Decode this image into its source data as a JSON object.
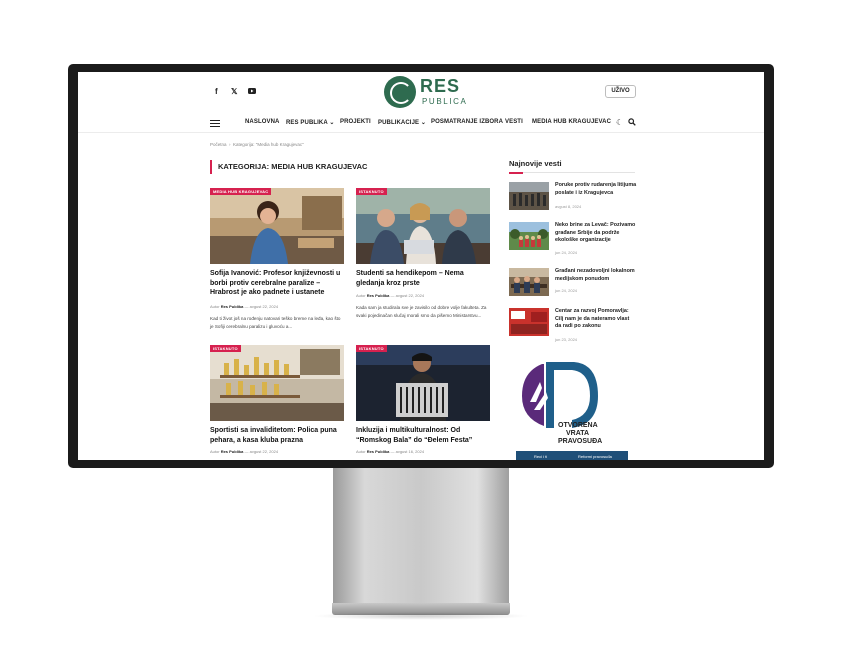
{
  "header": {
    "logo_top": "RES",
    "logo_bottom": "PUBLICA",
    "live_button": "UŽIVO",
    "social_icons": [
      "facebook-icon",
      "x-twitter-icon",
      "youtube-icon"
    ]
  },
  "nav": {
    "items": [
      {
        "label": "NASLOVNA"
      },
      {
        "label": "RES PUBLIKA ⌄"
      },
      {
        "label": "PROJEKTI"
      },
      {
        "label": "PUBLIKACIJE ⌄"
      },
      {
        "label": "POSMATRANJE IZBORA"
      },
      {
        "label": "VESTI"
      },
      {
        "label": "MEDIA HUB KRAGUJEVAC"
      }
    ],
    "icons": [
      "dark-mode-moon-icon",
      "search-icon"
    ]
  },
  "breadcrumb": {
    "home": "Početna",
    "separator": "›",
    "current": "Kategorija: \"Media hub Kragujevac\""
  },
  "category_title": "KATEGORIJA: MEDIA HUB KRAGUJEVAC",
  "articles": [
    {
      "tag": "MEDIA HUB KRAGUJEVAC",
      "title": "Sofija Ivanović: Profesor književnosti u borbi protiv cerebralne paralize – Hrabrost je ako padnete i ustanete",
      "author_prefix": "Autor",
      "author": "Res Publika",
      "date": "— avgust 22, 2024",
      "excerpt": "Kad ti život još na rođenju natovari teško breme na leđa, kao što je Sofiji cerebralnu paralizu i gluvoću a..."
    },
    {
      "tag": "ISTAKNUTO",
      "title": "Studenti sa hendikepom – Nema gledanja kroz prste",
      "author_prefix": "Autor",
      "author": "Res Publika",
      "date": "— avgust 22, 2024",
      "excerpt": "Kada sam ja studirala sve je zavisilo od dobre volje fakulteta. Za svaki pojedinačan slučaj morali smo da pišemo Ministarstvu..."
    },
    {
      "tag": "ISTAKNUTO",
      "title": "Sportisti sa invaliditetom: Polica puna pehara, a kasa kluba prazna",
      "author_prefix": "Autor",
      "author": "Res Publika",
      "date": "— avgust 22, 2024"
    },
    {
      "tag": "ISTAKNUTO",
      "title": "Inkluzija i multikulturalnost: Od “Romskog Bala” do “Đelem Festa”",
      "author_prefix": "Autor",
      "author": "Res Publika",
      "date": "— avgust 16, 2024"
    }
  ],
  "sidebar": {
    "title": "Najnovije vesti",
    "items": [
      {
        "title": "Poruke protiv rudarenja litijuma poslate i iz Kragujevca",
        "date": "avgust 8, 2024"
      },
      {
        "title": "Neko brine za Levač: Pozivamo građane Srbije da podrže ekološke organizacije",
        "date": "jun 24, 2024"
      },
      {
        "title": "Građani nezadovoljni lokalnom medijskom ponudom",
        "date": "jun 24, 2024"
      },
      {
        "title": "Centar za razvoj Pomoravlja: Cilj nam je da nateramo vlast da radi po zakonu",
        "date": "jun 23, 2024"
      }
    ],
    "banner": {
      "line1": "OTVORENA",
      "line2": "VRATA",
      "line3": "PRAVOSUĐA",
      "footer_left": "Reci i ti",
      "footer_right": "Reformi pravosuđa"
    }
  },
  "colors": {
    "accent": "#d6214f",
    "brand_green": "#2e6b4f",
    "banner_purple": "#5a2a7a"
  }
}
